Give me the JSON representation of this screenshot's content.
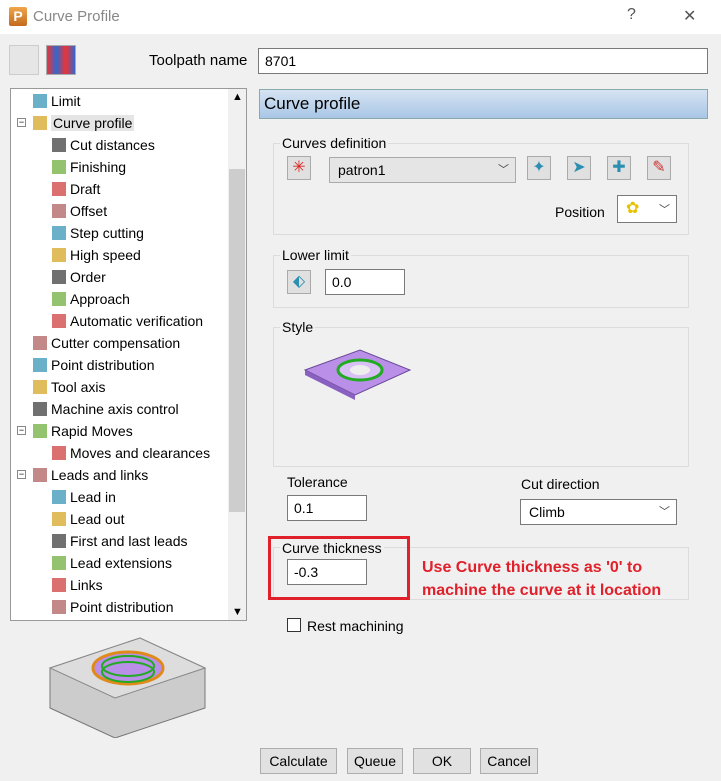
{
  "window": {
    "title": "Curve Profile",
    "help": "?",
    "close": "✕",
    "logo": "P"
  },
  "toolpath_name": {
    "label": "Toolpath name",
    "value": "8701"
  },
  "tree": {
    "items": [
      {
        "label": "Limit",
        "level": 1
      },
      {
        "label": "Curve profile",
        "level": 1,
        "expanded": true,
        "selected": true
      },
      {
        "label": "Cut distances",
        "level": 2
      },
      {
        "label": "Finishing",
        "level": 2
      },
      {
        "label": "Draft",
        "level": 2
      },
      {
        "label": "Offset",
        "level": 2
      },
      {
        "label": "Step cutting",
        "level": 2
      },
      {
        "label": "High speed",
        "level": 2
      },
      {
        "label": "Order",
        "level": 2
      },
      {
        "label": "Approach",
        "level": 2
      },
      {
        "label": "Automatic verification",
        "level": 2
      },
      {
        "label": "Cutter compensation",
        "level": 1
      },
      {
        "label": "Point distribution",
        "level": 1
      },
      {
        "label": "Tool axis",
        "level": 1
      },
      {
        "label": "Machine axis control",
        "level": 1
      },
      {
        "label": "Rapid Moves",
        "level": 1,
        "expanded": true
      },
      {
        "label": "Moves and clearances",
        "level": 2
      },
      {
        "label": "Leads and links",
        "level": 1,
        "expanded": true
      },
      {
        "label": "Lead in",
        "level": 2
      },
      {
        "label": "Lead out",
        "level": 2
      },
      {
        "label": "First and last leads",
        "level": 2
      },
      {
        "label": "Lead extensions",
        "level": 2
      },
      {
        "label": "Links",
        "level": 2
      },
      {
        "label": "Point distribution",
        "level": 2
      }
    ]
  },
  "panel": {
    "header": "Curve profile",
    "curves_definition": {
      "label": "Curves definition",
      "curve": "patron1",
      "position_label": "Position"
    },
    "lower_limit": {
      "label": "Lower limit",
      "value": "0.0"
    },
    "style": {
      "label": "Style"
    },
    "tolerance": {
      "label": "Tolerance",
      "value": "0.1"
    },
    "cut_direction": {
      "label": "Cut direction",
      "value": "Climb"
    },
    "curve_thickness": {
      "label": "Curve thickness",
      "value": "-0.3"
    },
    "rest_machining": {
      "label": "Rest machining",
      "checked": false
    }
  },
  "annotation": {
    "text_line1": "Use Curve thickness as '0' to",
    "text_line2": "machine the curve at it location",
    "color": "#e0202a"
  },
  "buttons": {
    "calculate": "Calculate",
    "queue": "Queue",
    "ok": "OK",
    "cancel": "Cancel"
  }
}
